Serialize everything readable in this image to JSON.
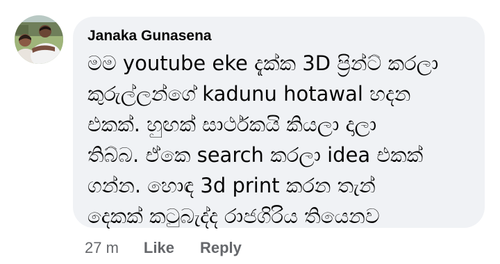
{
  "comment": {
    "author": "Janaka Gunasena",
    "text_lines": [
      "මම youtube eke දැක්ක 3D ප්‍රින්ට් කරලා",
      "කුරුල්ලන්ගේ kadunu hotawal හදන",
      "එකක්. හුඟක් සාර්ථකයි කියලා දාලා",
      "තිබ්බ. ඒකෙ search කරලා idea එකක්",
      "ගන්න. හොඳ 3d print කරන තැන්",
      "දෙකක් කටුබැද්ද රාජගිරිය තියෙනව"
    ],
    "timestamp": "27 m",
    "like_label": "Like",
    "reply_label": "Reply"
  },
  "colors": {
    "bubble_background": "#f0f2f5",
    "text": "#050505",
    "meta_text": "#65676b"
  },
  "icons": {
    "avatar": "profile-photo"
  }
}
